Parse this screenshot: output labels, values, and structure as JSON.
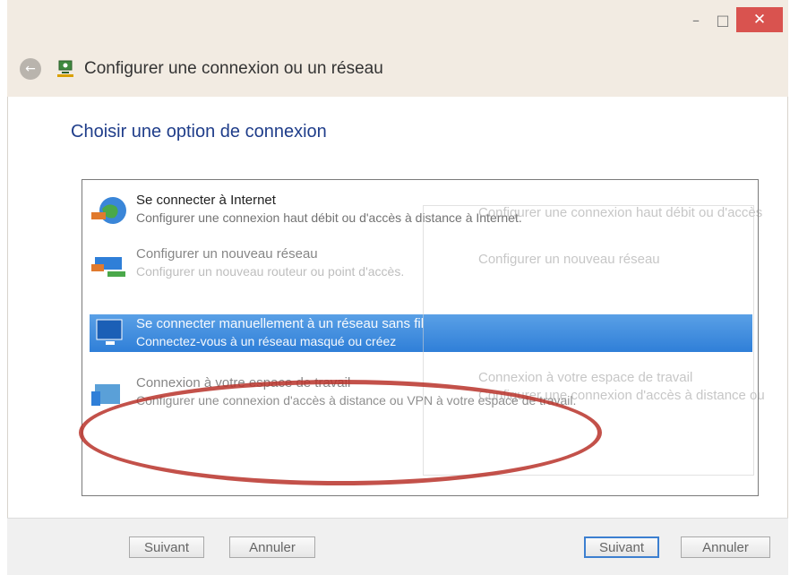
{
  "window": {
    "title": "Configurer une connexion ou un réseau",
    "controls": {
      "minimize": "–",
      "maximize": "□",
      "close": "✕"
    }
  },
  "main": {
    "heading": "Choisir une option de connexion",
    "options": [
      {
        "title": "Se connecter à Internet",
        "desc": "Configurer une connexion haut débit ou d'accès à distance à Internet."
      },
      {
        "title": "Configurer un nouveau réseau",
        "desc": "Configurer un nouveau routeur ou point d'accès."
      },
      {
        "title": "Se connecter manuellement à un réseau sans fil",
        "desc": "Connectez-vous à un réseau masqué ou créez"
      },
      {
        "title": "Connexion à votre espace de travail",
        "desc": "Configurer une connexion d'accès à distance ou VPN à votre espace de travail."
      }
    ],
    "ghost": {
      "g1": "Configurer une connexion haut débit ou d'accès",
      "g2": "Configurer un nouveau réseau",
      "g3": "Connexion à votre espace de travail",
      "g4": "Configurer une connexion d'accès à distance ou"
    }
  },
  "footer": {
    "next_label": "Suivant",
    "cancel_label": "Annuler"
  },
  "colors": {
    "heading": "#1f3d8a",
    "selection": "#2f7fd8",
    "annotation": "#b8332a",
    "close_button": "#d9534f"
  },
  "icons": [
    "back-arrow-icon",
    "network-setup-icon",
    "globe-icon",
    "router-icon",
    "wireless-monitor-icon",
    "workplace-icon"
  ]
}
